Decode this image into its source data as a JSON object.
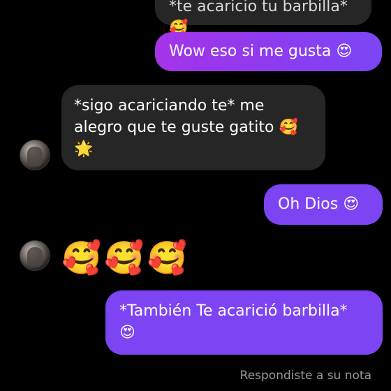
{
  "messages": [
    {
      "side": "out",
      "text": "*te acaricio tu barbilla* 🥰"
    },
    {
      "side": "out",
      "text": "Wow eso si me gusta 😍"
    },
    {
      "side": "in",
      "text": "*sigo acariciando te* me alegro que te guste gatito 🥰\n🌟"
    },
    {
      "side": "out",
      "text": "Oh Dios 😍"
    },
    {
      "side": "in",
      "text": "🥰🥰🥰"
    },
    {
      "side": "out",
      "text": "*También Te acarició barbilla*\n😍"
    }
  ],
  "footer": {
    "text": "Respondiste a su nota"
  },
  "colors": {
    "background": "#000000",
    "incoming_bubble": "#262626",
    "outgoing_bubble_start": "#a533e8",
    "outgoing_bubble_end": "#7a46f6",
    "text": "#ffffff",
    "footer_text": "#9a9a9a"
  }
}
